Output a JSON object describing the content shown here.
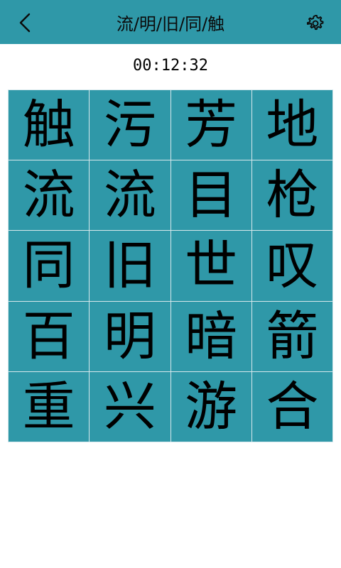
{
  "header": {
    "title": "流/明/旧/同/触",
    "back_icon": "back-chevron-icon",
    "settings_icon": "gear-icon",
    "accent_color": "#2f98a8"
  },
  "timer": {
    "value": "00:12:32"
  },
  "grid": {
    "rows": [
      [
        "触",
        "污",
        "芳",
        "地"
      ],
      [
        "流",
        "流",
        "目",
        "枪"
      ],
      [
        "同",
        "旧",
        "世",
        "叹"
      ],
      [
        "百",
        "明",
        "暗",
        "箭"
      ],
      [
        "重",
        "兴",
        "游",
        "合"
      ]
    ]
  }
}
